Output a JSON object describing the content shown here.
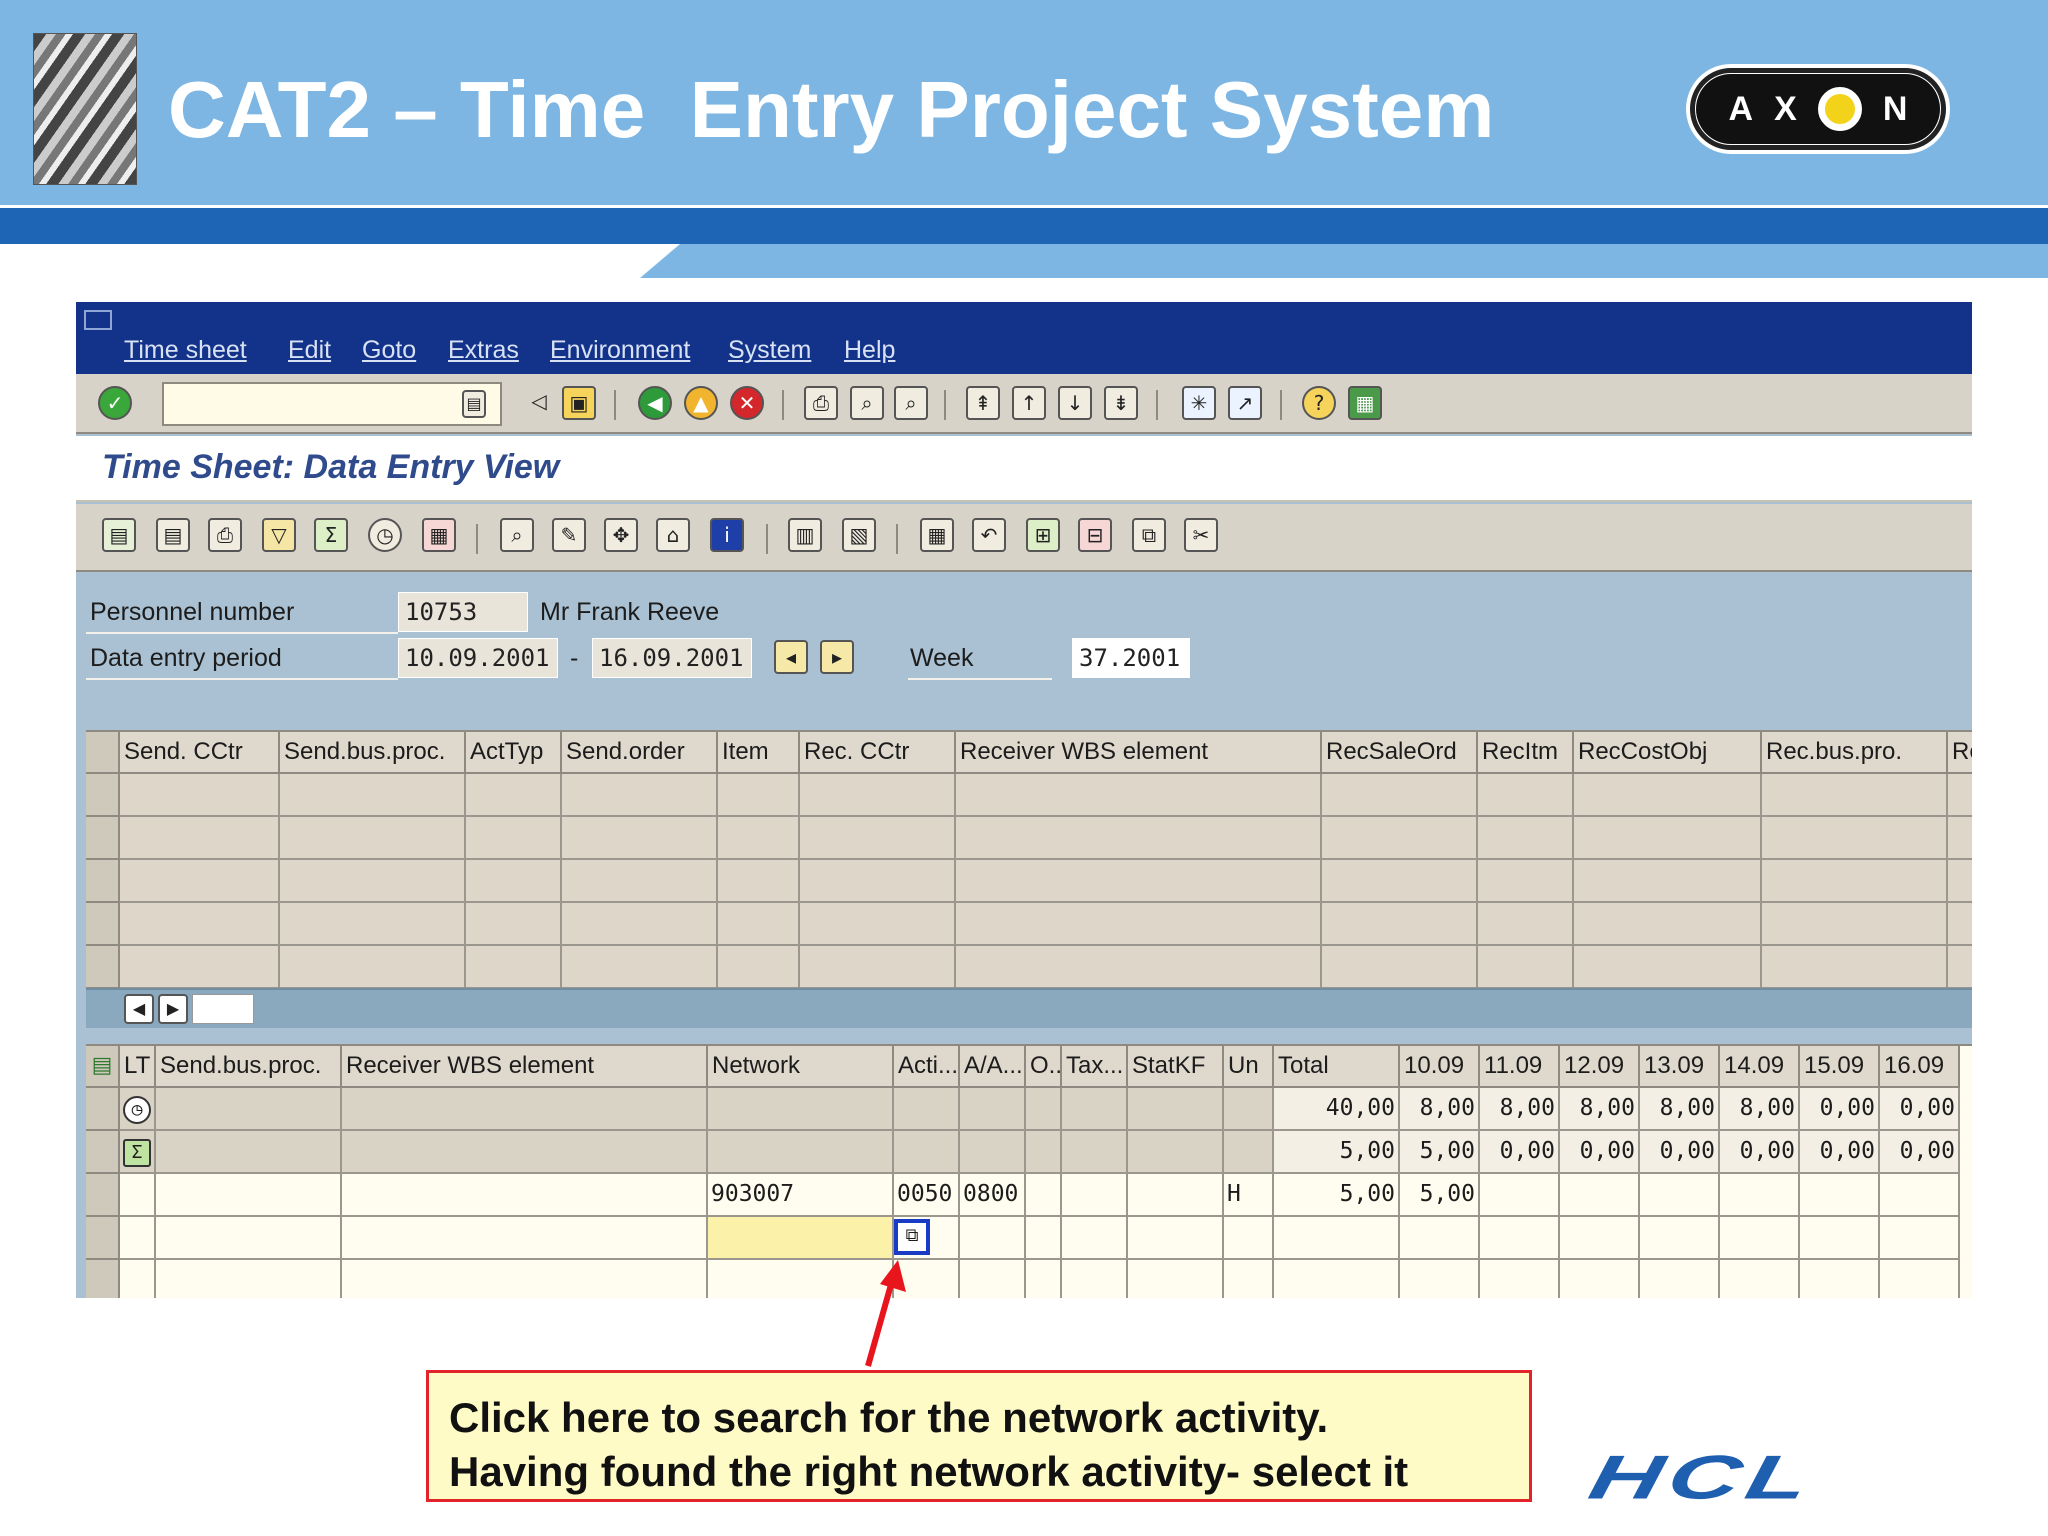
{
  "slide": {
    "title": "CAT2 – Time  Entry Project System",
    "brand_logo": "A X O N",
    "axon_letters": [
      "A",
      "X",
      "N"
    ],
    "footer_logo": "HCL",
    "callout": {
      "line1": "Click here to search for the network activity.",
      "line2": "Having found the right network activity- select it"
    }
  },
  "menu": [
    "Time sheet",
    "Edit",
    "Goto",
    "Extras",
    "Environment",
    "System",
    "Help"
  ],
  "view_title": "Time Sheet: Data Entry View",
  "header_fields": {
    "personnel_label": "Personnel number",
    "personnel_number": "10753",
    "personnel_name": "Mr Frank Reeve",
    "period_label": "Data entry period",
    "period_from": "10.09.2001",
    "period_sep": "-",
    "period_to": "16.09.2001",
    "week_label": "Week",
    "week_value": "37.2001"
  },
  "upper_table": {
    "columns": [
      "Send. CCtr",
      "Send.bus.proc.",
      "ActTyp",
      "Send.order",
      "Item",
      "Rec. CCtr",
      "Receiver WBS element",
      "RecSaleOrd",
      "RecItm",
      "RecCostObj",
      "Rec.bus.pro.",
      "Re"
    ]
  },
  "lower_table": {
    "columns": [
      "LT",
      "Send.bus.proc.",
      "Receiver WBS element",
      "Network",
      "Acti...",
      "A/A...",
      "O..",
      "Tax...",
      "StatKF",
      "Un",
      "Total",
      "10.09",
      "11.09",
      "12.09",
      "13.09",
      "14.09",
      "15.09",
      "16.09"
    ],
    "rows": [
      {
        "icon": "clock-icon",
        "total": "40,00",
        "days": [
          "8,00",
          "8,00",
          "8,00",
          "8,00",
          "8,00",
          "0,00",
          "0,00"
        ]
      },
      {
        "icon": "sigma-icon",
        "total": "5,00",
        "days": [
          "5,00",
          "0,00",
          "0,00",
          "0,00",
          "0,00",
          "0,00",
          "0,00"
        ]
      },
      {
        "network": "903007",
        "activity": "0050",
        "aa": "0800",
        "unit": "H",
        "total": "5,00",
        "days": [
          "5,00",
          "",
          "",
          "",
          "",
          "",
          ""
        ]
      }
    ]
  },
  "colors": {
    "header_blue": "#7db6e3",
    "band_blue": "#1e66b5",
    "sap_menu": "#13338a",
    "sap_bg": "#a9c1d2",
    "callout_border": "#e0242a",
    "hcl_blue": "#1f5fb0"
  },
  "icons": [
    "enter-icon",
    "save-icon",
    "back-icon",
    "exit-icon",
    "cancel-icon",
    "print-icon",
    "find-icon",
    "find-next-icon",
    "first-page-icon",
    "prev-page-icon",
    "next-page-icon",
    "last-page-icon",
    "new-session-icon",
    "shortcut-icon",
    "help-icon",
    "layout-icon"
  ]
}
